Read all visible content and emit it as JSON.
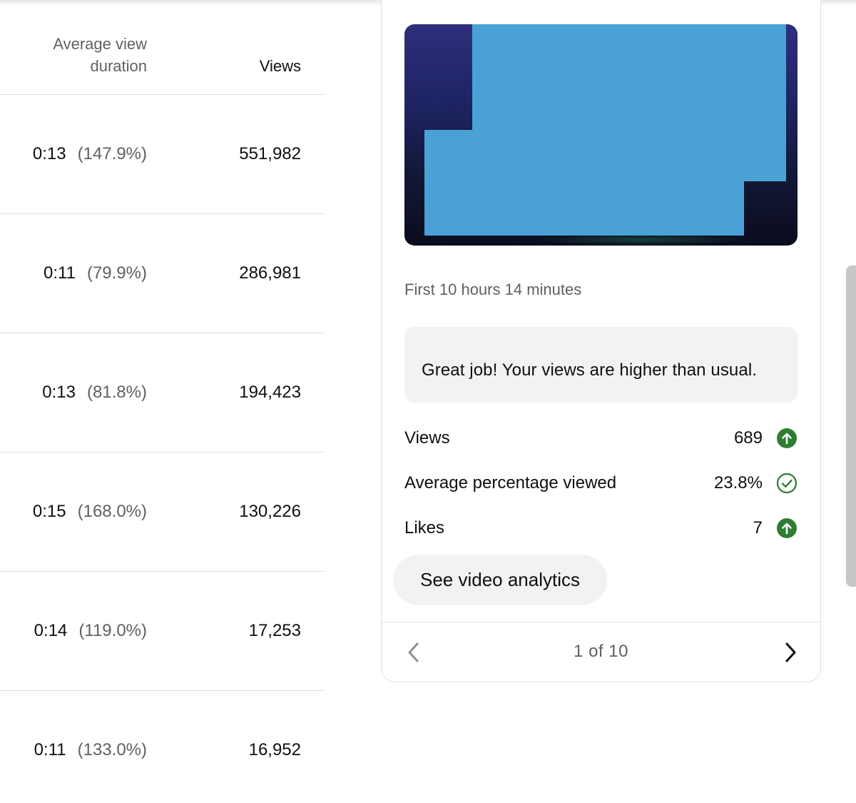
{
  "table": {
    "headers": {
      "avg_view_duration": "Average view duration",
      "views": "Views"
    },
    "rows": [
      {
        "duration": "0:13",
        "percent": "(147.9%)",
        "views": "551,982"
      },
      {
        "duration": "0:11",
        "percent": "(79.9%)",
        "views": "286,981"
      },
      {
        "duration": "0:13",
        "percent": "(81.8%)",
        "views": "194,423"
      },
      {
        "duration": "0:15",
        "percent": "(168.0%)",
        "views": "130,226"
      },
      {
        "duration": "0:14",
        "percent": "(119.0%)",
        "views": "17,253"
      },
      {
        "duration": "0:11",
        "percent": "(133.0%)",
        "views": "16,952"
      }
    ]
  },
  "card": {
    "period": "First 10 hours 14 minutes",
    "message": "Great job! Your views are higher than usual.",
    "metrics": [
      {
        "label": "Views",
        "value": "689",
        "icon": "arrow-up-circle-icon"
      },
      {
        "label": "Average percentage viewed",
        "value": "23.8%",
        "icon": "check-circle-icon"
      },
      {
        "label": "Likes",
        "value": "7",
        "icon": "arrow-up-circle-icon"
      }
    ],
    "button_label": "See video analytics",
    "pager": {
      "label": "1 of 10"
    }
  },
  "colors": {
    "positive": "#2e7d32",
    "redaction": "#4aa1d6",
    "secondary_text": "#606060",
    "chip_bg": "#f2f2f2"
  }
}
